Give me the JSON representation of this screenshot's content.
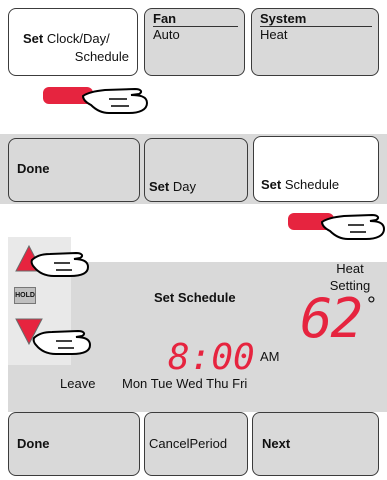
{
  "section1": {
    "set_clock": {
      "bold": "Set",
      "rest": "Clock/Day/",
      "line2": "Schedule"
    },
    "fan": {
      "label": "Fan",
      "value": "Auto"
    },
    "system": {
      "label": "System",
      "value": "Heat"
    }
  },
  "section2": {
    "done": "Done",
    "set_day": {
      "bold": "Set",
      "rest": "Day"
    },
    "set_schedule": {
      "bold": "Set",
      "rest": "Schedule"
    }
  },
  "section3": {
    "hold": "HOLD",
    "title": "Set Schedule",
    "heat_setting_line1": "Heat",
    "heat_setting_line2": "Setting",
    "temperature": "62",
    "degree": "°",
    "time": "8:00",
    "ampm": "AM",
    "period": "Leave",
    "days": [
      "Mon",
      "Tue",
      "Wed",
      "Thu",
      "Fri"
    ],
    "buttons": {
      "done": "Done",
      "cancel_period": "CancelPeriod",
      "next": "Next"
    }
  },
  "colors": {
    "accent": "#e6243f",
    "panel": "#d9d9d9",
    "border": "#3c3c3c"
  }
}
